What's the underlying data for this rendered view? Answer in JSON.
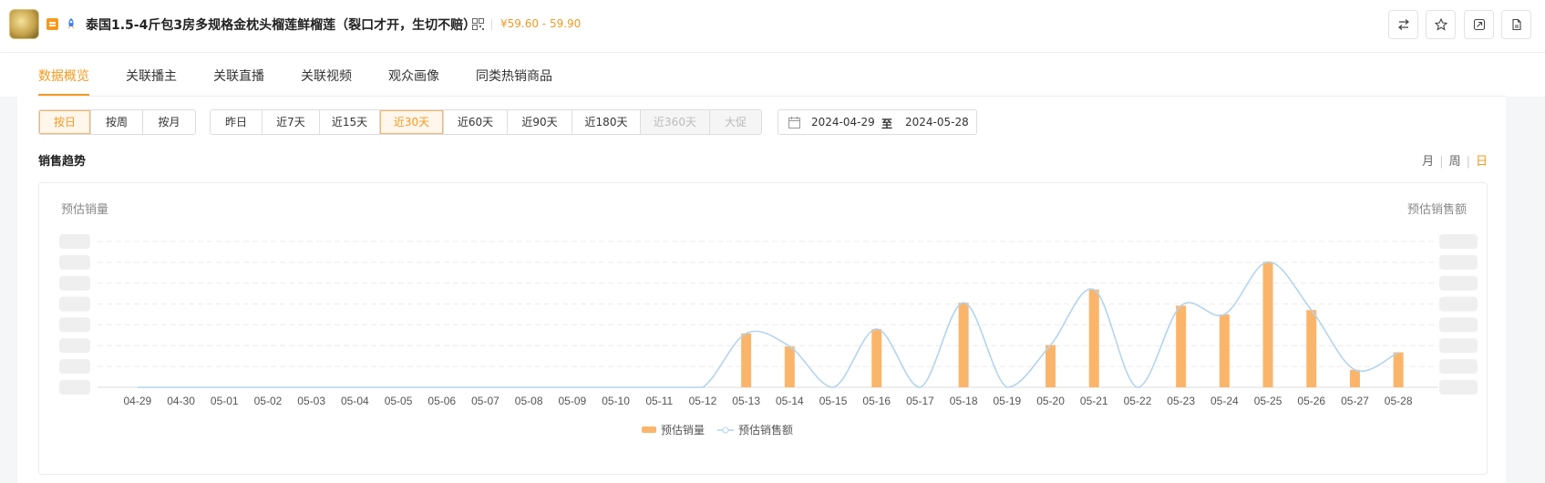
{
  "header": {
    "title": "泰国1.5-4斤包3房多规格金枕头榴莲鲜榴莲（裂口才开，生切不赔）",
    "price": "¥59.60 - 59.90",
    "icons": [
      "thumbnail",
      "tag-icon",
      "rocket-icon",
      "qr-code-icon",
      "switch-icon",
      "star-icon",
      "tag-link-icon",
      "document-icon"
    ]
  },
  "tabs": [
    "数据概览",
    "关联播主",
    "关联直播",
    "关联视频",
    "观众画像",
    "同类热销商品"
  ],
  "filters": {
    "period_type": [
      {
        "label": "按日",
        "active": true
      },
      {
        "label": "按周",
        "active": false
      },
      {
        "label": "按月",
        "active": false
      }
    ],
    "ranges": [
      {
        "label": "昨日",
        "state": "normal"
      },
      {
        "label": "近7天",
        "state": "normal"
      },
      {
        "label": "近15天",
        "state": "normal"
      },
      {
        "label": "近30天",
        "state": "active"
      },
      {
        "label": "近60天",
        "state": "normal"
      },
      {
        "label": "近90天",
        "state": "normal"
      },
      {
        "label": "近180天",
        "state": "normal"
      },
      {
        "label": "近360天",
        "state": "disabled"
      },
      {
        "label": "大促",
        "state": "disabled"
      }
    ],
    "date_start": "2024-04-29",
    "date_sep": "至",
    "date_end": "2024-05-28"
  },
  "section": {
    "title": "销售趋势",
    "granularity": [
      "月",
      "周",
      "日"
    ],
    "granularity_active": "日"
  },
  "colors": {
    "accent": "#f39a1f",
    "bar": "#fbb56b",
    "line": "#b3d4ee"
  },
  "chart_data": {
    "type": "bar+line",
    "ylabel_left": "预估销量",
    "ylabel_right": "预估销售额",
    "y_tick_labels_blurred": true,
    "grid": true,
    "legend_position": "bottom-center",
    "categories": [
      "04-29",
      "04-30",
      "05-01",
      "05-02",
      "05-03",
      "05-04",
      "05-05",
      "05-06",
      "05-07",
      "05-08",
      "05-09",
      "05-10",
      "05-11",
      "05-12",
      "05-13",
      "05-14",
      "05-15",
      "05-16",
      "05-17",
      "05-18",
      "05-19",
      "05-20",
      "05-21",
      "05-22",
      "05-23",
      "05-24",
      "05-25",
      "05-26",
      "05-27",
      "05-28"
    ],
    "series": [
      {
        "name": "预估销量",
        "kind": "bar",
        "values": [
          0,
          0,
          0,
          0,
          0,
          0,
          0,
          0,
          0,
          0,
          0,
          0,
          0,
          0,
          37,
          28,
          0,
          40,
          0,
          58,
          0,
          29,
          67,
          0,
          56,
          50,
          86,
          53,
          12,
          24
        ]
      },
      {
        "name": "预估销售额",
        "kind": "line",
        "values": [
          0,
          0,
          0,
          0,
          0,
          0,
          0,
          0,
          0,
          0,
          0,
          0,
          0,
          0,
          37,
          28,
          0,
          40,
          0,
          58,
          0,
          29,
          67,
          0,
          56,
          50,
          86,
          53,
          12,
          24
        ]
      }
    ],
    "ylim": [
      0,
      100
    ]
  }
}
